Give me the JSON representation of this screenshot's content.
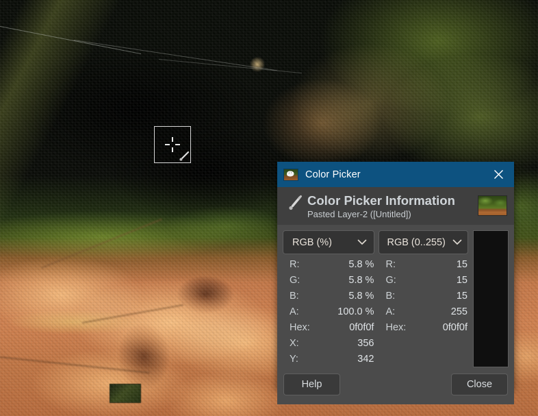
{
  "canvas": {
    "name": "image-canvas",
    "description": "GIMP image canvas showing a zoomed macro photograph"
  },
  "cursor": {
    "icon": "eyedropper-crosshair-cursor"
  },
  "dialog": {
    "titlebar": {
      "icon": "gimp-wilber-icon",
      "title": "Color Picker",
      "close_icon": "close-icon"
    },
    "header": {
      "icon": "pipette-icon",
      "heading": "Color Picker Information",
      "subheading": "Pasted Layer-2 ([Untitled])",
      "thumbnail_icon": "image-thumbnail"
    },
    "left_panel": {
      "mode_label": "RGB (%)",
      "chevron_icon": "chevron-down-icon",
      "rows": [
        {
          "key": "R:",
          "value": "5.8 %"
        },
        {
          "key": "G:",
          "value": "5.8 %"
        },
        {
          "key": "B:",
          "value": "5.8 %"
        },
        {
          "key": "A:",
          "value": "100.0 %"
        },
        {
          "key": "Hex:",
          "value": "0f0f0f"
        },
        {
          "key": "X:",
          "value": "356"
        },
        {
          "key": "Y:",
          "value": "342"
        }
      ]
    },
    "right_panel": {
      "mode_label": "RGB (0..255)",
      "chevron_icon": "chevron-down-icon",
      "rows": [
        {
          "key": "R:",
          "value": "15"
        },
        {
          "key": "G:",
          "value": "15"
        },
        {
          "key": "B:",
          "value": "15"
        },
        {
          "key": "A:",
          "value": "255"
        },
        {
          "key": "Hex:",
          "value": "0f0f0f"
        }
      ]
    },
    "swatch": {
      "color": "#0f0f0f"
    },
    "footer": {
      "help_label": "Help",
      "close_label": "Close"
    }
  },
  "colors": {
    "titlebar_bg": "#0d5280",
    "dialog_bg": "#4b4b4b",
    "header_bg": "#3f3f3f",
    "control_bg": "#333333",
    "text": "#ccd1d4",
    "picked_color": "#0f0f0f"
  }
}
